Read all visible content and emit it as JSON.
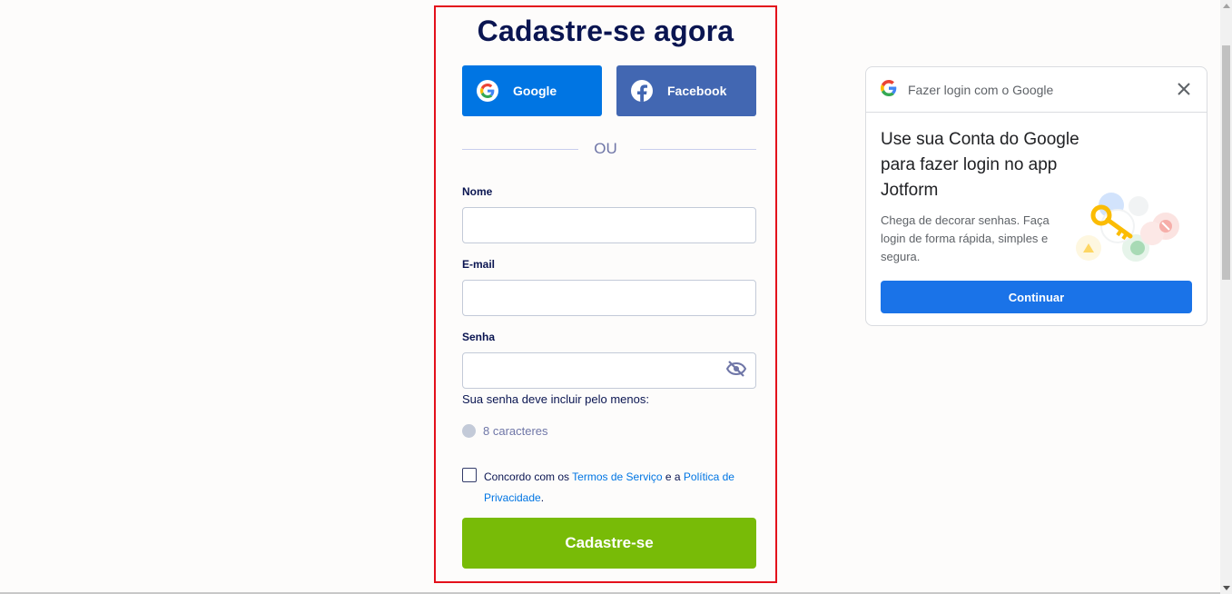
{
  "signup": {
    "title": "Cadastre-se agora",
    "google_label": "Google",
    "facebook_label": "Facebook",
    "or_text": "OU",
    "name_label": "Nome",
    "name_value": "",
    "email_label": "E-mail",
    "email_value": "",
    "password_label": "Senha",
    "password_value": "",
    "password_hint": "Sua senha deve incluir pelo menos:",
    "requirement": "8 caracteres",
    "agree_prefix": "Concordo com os ",
    "terms_link": "Termos de Serviço",
    "agree_middle": " e a ",
    "privacy_link": "Política de Privacidade",
    "agree_suffix": ".",
    "submit_label": "Cadastre-se"
  },
  "google_onetap": {
    "header": "Fazer login com o Google",
    "title": "Use sua Conta do Google para fazer login no app Jotform",
    "description": "Chega de decorar senhas. Faça login de forma rápida, simples e segura.",
    "continue_label": "Continuar"
  },
  "colors": {
    "google_button": "#0075e3",
    "facebook_button": "#4267b2",
    "submit_button": "#78bb07",
    "highlight_border": "#e3101b",
    "continue_button": "#1a73e8"
  },
  "icons": [
    "google-icon",
    "facebook-icon",
    "eye-off-icon",
    "close-icon",
    "key-illustration"
  ]
}
